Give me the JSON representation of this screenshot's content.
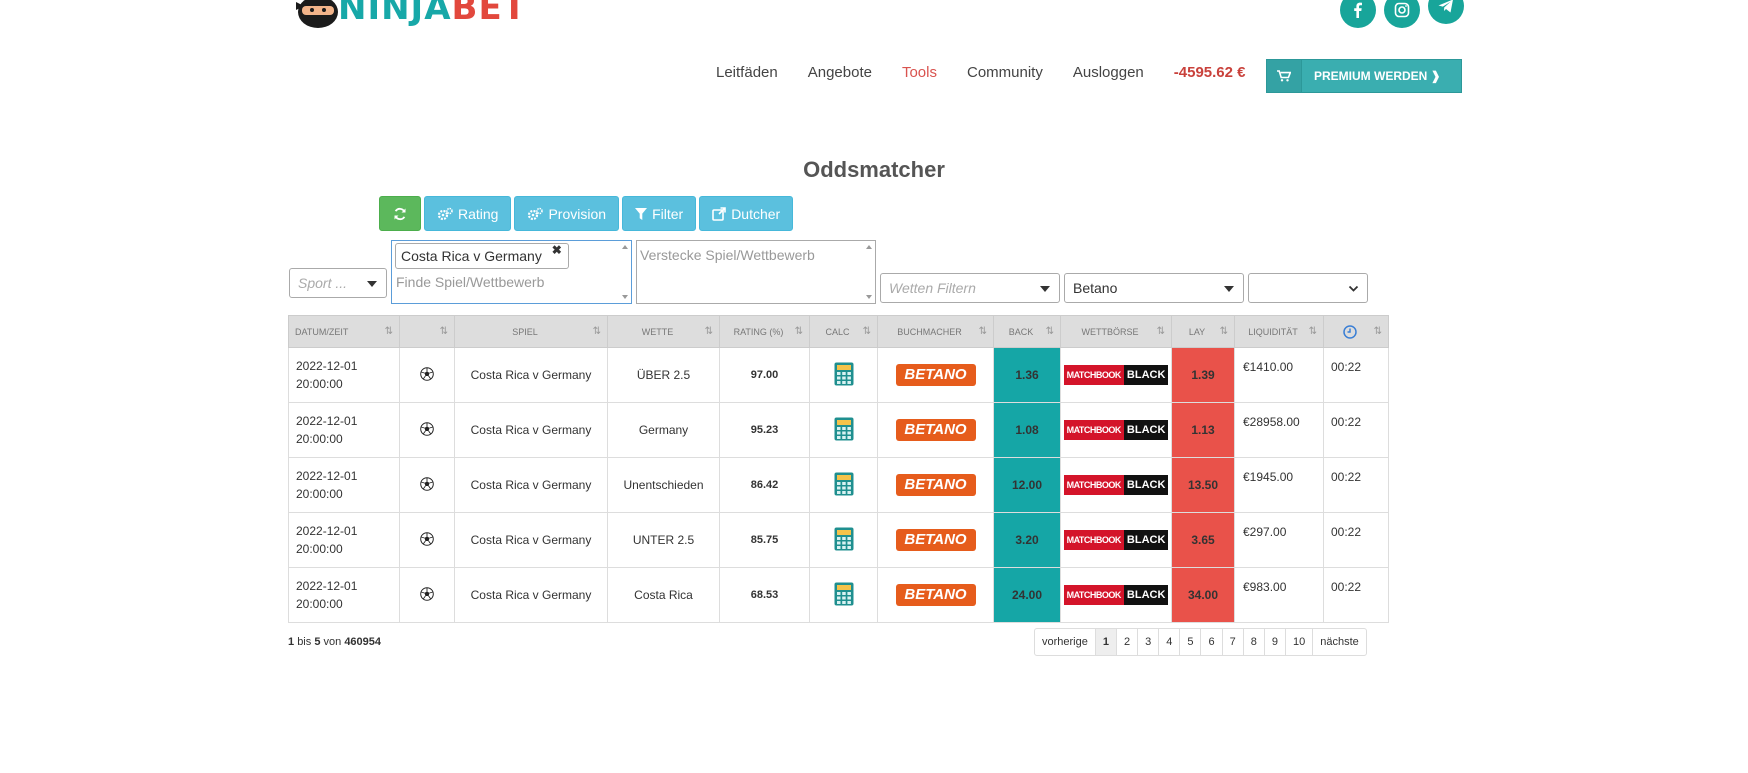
{
  "header": {
    "logo_ninja": "NINJA",
    "logo_bet": "BET",
    "social": [
      "facebook-icon",
      "instagram-icon",
      "telegram-icon"
    ],
    "nav": [
      "Leitfäden",
      "Angebote",
      "Tools",
      "Community",
      "Ausloggen"
    ],
    "active_nav": "Tools",
    "balance": "-4595.62 €",
    "premium_label": "PREMIUM WERDEN ❱"
  },
  "page_title": "Oddsmatcher",
  "toolbar": {
    "refresh_icon": "refresh-icon",
    "rating_label": "Rating",
    "provision_label": "Provision",
    "filter_label": "Filter",
    "dutcher_label": "Dutcher"
  },
  "filters": {
    "sport_placeholder": "Sport ...",
    "find_tag": "Costa Rica v Germany",
    "find_placeholder": "Finde Spiel/Wettbewerb",
    "hide_placeholder": "Verstecke Spiel/Wettbewerb",
    "wetten_placeholder": "Wetten Filtern",
    "bookmaker_selected": "Betano",
    "extra_selected": ""
  },
  "table": {
    "headers": [
      "DATUM/ZEIT",
      "",
      "SPIEL",
      "WETTE",
      "RATING (%)",
      "CALC",
      "BUCHMACHER",
      "BACK",
      "WETTBÖRSE",
      "LAY",
      "LIQUIDITÄT",
      ""
    ],
    "rows": [
      {
        "date": "2022-12-01",
        "time": "20:00:00",
        "game": "Costa Rica v Germany",
        "bet": "ÜBER 2.5",
        "rating": "97.00",
        "bookmaker": "BETANO",
        "back": "1.36",
        "exchange_a": "MATCHBOOK",
        "exchange_b": "BLACK",
        "lay": "1.39",
        "liquidity": "€1410.00",
        "clock": "00:22"
      },
      {
        "date": "2022-12-01",
        "time": "20:00:00",
        "game": "Costa Rica v Germany",
        "bet": "Germany",
        "rating": "95.23",
        "bookmaker": "BETANO",
        "back": "1.08",
        "exchange_a": "MATCHBOOK",
        "exchange_b": "BLACK",
        "lay": "1.13",
        "liquidity": "€28958.00",
        "clock": "00:22"
      },
      {
        "date": "2022-12-01",
        "time": "20:00:00",
        "game": "Costa Rica v Germany",
        "bet": "Unentschieden",
        "rating": "86.42",
        "bookmaker": "BETANO",
        "back": "12.00",
        "exchange_a": "MATCHBOOK",
        "exchange_b": "BLACK",
        "lay": "13.50",
        "liquidity": "€1945.00",
        "clock": "00:22"
      },
      {
        "date": "2022-12-01",
        "time": "20:00:00",
        "game": "Costa Rica v Germany",
        "bet": "UNTER 2.5",
        "rating": "85.75",
        "bookmaker": "BETANO",
        "back": "3.20",
        "exchange_a": "MATCHBOOK",
        "exchange_b": "BLACK",
        "lay": "3.65",
        "liquidity": "€297.00",
        "clock": "00:22"
      },
      {
        "date": "2022-12-01",
        "time": "20:00:00",
        "game": "Costa Rica v Germany",
        "bet": "Costa Rica",
        "rating": "68.53",
        "bookmaker": "BETANO",
        "back": "24.00",
        "exchange_a": "MATCHBOOK",
        "exchange_b": "BLACK",
        "lay": "34.00",
        "liquidity": "€983.00",
        "clock": "00:22"
      }
    ]
  },
  "footer": {
    "from": "1",
    "bis": "bis",
    "to": "5",
    "von": "von",
    "total": "460954",
    "prev": "vorherige",
    "pages": [
      "1",
      "2",
      "3",
      "4",
      "5",
      "6",
      "7",
      "8",
      "9",
      "10"
    ],
    "current_page": "1",
    "next": "nächste"
  },
  "colors": {
    "teal": "#15a6a6",
    "red": "#e9524a",
    "green_btn": "#5cb85c",
    "blue_btn": "#5bc0de",
    "betano": "#e65c1c"
  }
}
